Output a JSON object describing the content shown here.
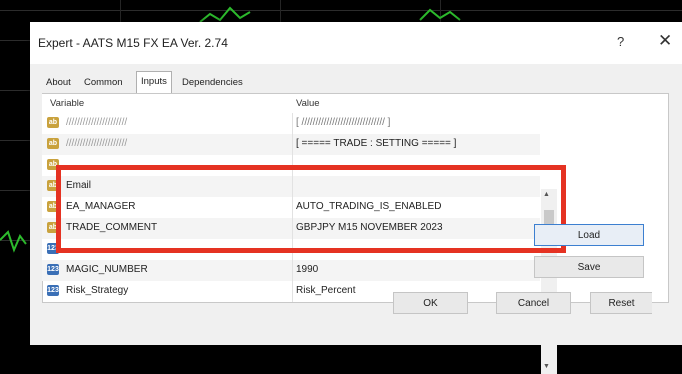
{
  "dialog": {
    "title": "Expert - AATS M15 FX EA Ver. 2.74",
    "help_label": "?",
    "close_label": "✕"
  },
  "tabs": [
    {
      "label": "About"
    },
    {
      "label": "Common"
    },
    {
      "label": "Inputs"
    },
    {
      "label": "Dependencies"
    }
  ],
  "active_tab": "Inputs",
  "grid": {
    "columns": [
      "Variable",
      "Value"
    ],
    "rows": [
      {
        "variable": "//////////////////////",
        "value": "[ ////////////////////////////// ]",
        "icon": "ab",
        "icon_label": "ab"
      },
      {
        "variable": "//////////////////////",
        "value": "[ ===== TRADE : SETTING ===== ]",
        "icon": "ab",
        "icon_label": "ab"
      },
      {
        "variable": "",
        "value": "",
        "icon": "ab",
        "icon_label": "ab"
      },
      {
        "variable": "Email",
        "value": "",
        "icon": "ab",
        "icon_label": "ab"
      },
      {
        "variable": "EA_MANAGER",
        "value": "AUTO_TRADING_IS_ENABLED",
        "icon": "ab",
        "icon_label": "ab"
      },
      {
        "variable": "TRADE_COMMENT",
        "value": "GBPJPY   M15    NOVEMBER 2023",
        "icon": "ab",
        "icon_label": "ab"
      },
      {
        "variable": "",
        "value": "",
        "icon": "num",
        "icon_label": "123"
      },
      {
        "variable": "MAGIC_NUMBER",
        "value": "1990",
        "icon": "num",
        "icon_label": "123"
      },
      {
        "variable": "Risk_Strategy",
        "value": "Risk_Percent",
        "icon": "num",
        "icon_label": "123"
      }
    ]
  },
  "buttons": {
    "load": "Load",
    "save": "Save",
    "ok": "OK",
    "cancel": "Cancel",
    "reset": "Reset"
  },
  "colors": {
    "highlight": "#e53222",
    "chart_background": "#000000",
    "panel": "#f0f0f0"
  }
}
